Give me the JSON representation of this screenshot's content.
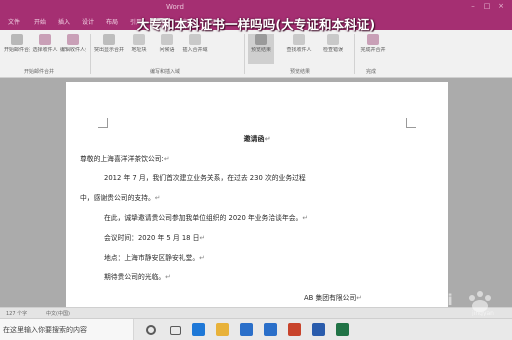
{
  "window": {
    "doc_name": "Word"
  },
  "headline": "大专和本科证书一样吗吗(大专证和本科证)",
  "ribbon": {
    "tabs": [
      "文件",
      "开始",
      "插入",
      "设计",
      "布局",
      "引用",
      "邮件",
      "审阅",
      "视图"
    ],
    "buttons": [
      {
        "label": "开始邮件合并",
        "color": "#b8b8b8"
      },
      {
        "label": "选择收件人",
        "color": "#c9a0b7"
      },
      {
        "label": "编辑收件人列表",
        "color": "#c9a0b7"
      },
      {
        "label": "突出显示合并域",
        "color": "#bdbdbd"
      },
      {
        "label": "地址块",
        "color": "#c9c9c9"
      },
      {
        "label": "问候语",
        "color": "#c9c9c9"
      },
      {
        "label": "插入合并域",
        "color": "#c9c9c9"
      },
      {
        "label": "预览结果",
        "color": "#9a9a9a"
      },
      {
        "label": "查找收件人",
        "color": "#c9c9c9"
      },
      {
        "label": "检查错误",
        "color": "#c9c9c9"
      },
      {
        "label": "完成并合并",
        "color": "#c9a0b7"
      }
    ],
    "groups": [
      "开始邮件合并",
      "编写和插入域",
      "预览结果",
      "完成"
    ]
  },
  "document": {
    "title": "邀请函",
    "salutation": "尊敬的上海喜洋洋茶饮公司:",
    "body_line1": "2012 年 7 月，我们首次建立业务关系，在过去 230 次的业务过程",
    "body_line2": "中，感谢贵公司的支持。",
    "body_line3": "在此，诚挚邀请贵公司参加我单位组织的 2020 年业务洽谈年会。",
    "meeting_time": "会议时间：2020 年 5 月 18 日",
    "location": "地点：上海市静安区静安礼堂。",
    "closing": "期待贵公司的光临。",
    "signature": "AB 集团有限公司",
    "para_mark": "↵"
  },
  "statusbar": {
    "word_count": "127 个字",
    "language": "中文(中国)"
  },
  "taskbar": {
    "search_text": "在这里输入你要搜索的内容",
    "apps": [
      {
        "name": "cortana",
        "color": "#5a5a5a"
      },
      {
        "name": "task-view",
        "color": "#5a5a5a"
      },
      {
        "name": "edge",
        "color": "#1e78d7"
      },
      {
        "name": "file-explorer",
        "color": "#e8b23a"
      },
      {
        "name": "store",
        "color": "#2a6fc9"
      },
      {
        "name": "mail",
        "color": "#2a6fc9"
      },
      {
        "name": "powerpoint",
        "color": "#c8442c"
      },
      {
        "name": "word",
        "color": "#2a5cac"
      },
      {
        "name": "excel",
        "color": "#217346"
      }
    ]
  },
  "watermark": "Bai百度 经验"
}
